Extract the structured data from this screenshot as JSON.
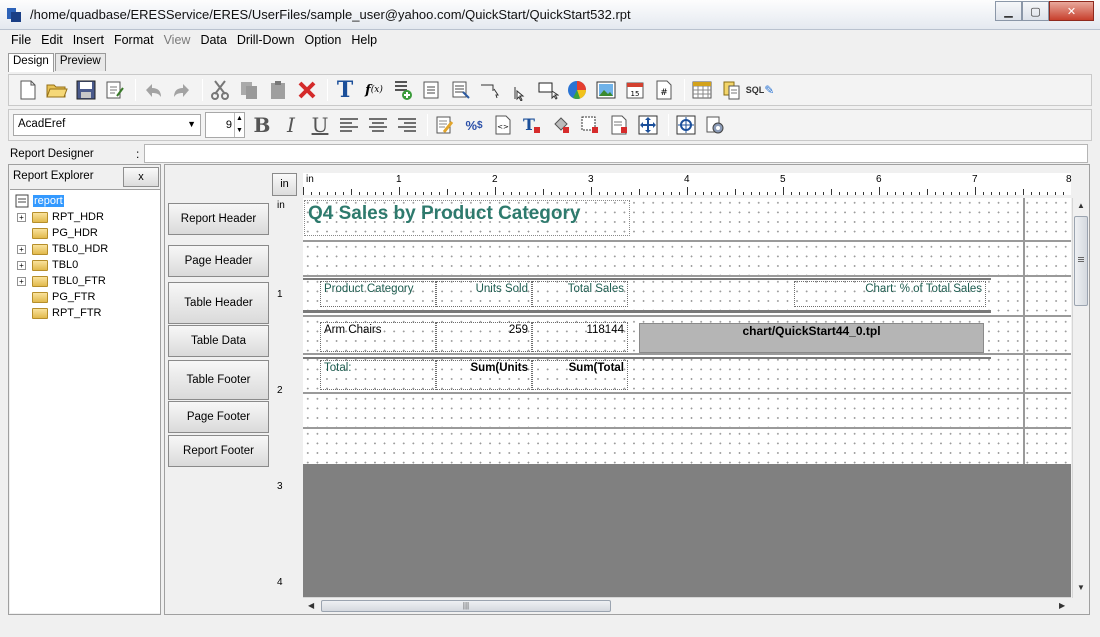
{
  "window": {
    "title": "/home/quadbase/ERESService/ERES/UserFiles/sample_user@yahoo.com/QuickStart/QuickStart532.rpt",
    "minimize": "▁",
    "maximize": "▢",
    "close": "✕"
  },
  "menu": [
    "File",
    "Edit",
    "Insert",
    "Format",
    "View",
    "Data",
    "Drill-Down",
    "Option",
    "Help"
  ],
  "tabs": [
    "Design",
    "Preview"
  ],
  "format": {
    "font": "AcadEref",
    "size": "9"
  },
  "designer": {
    "label": "Report Designer",
    "colon": ":",
    "value": ""
  },
  "explorer": {
    "title": "Report Explorer",
    "close": "x",
    "root": "report",
    "nodes": [
      "RPT_HDR",
      "PG_HDR",
      "TBL0_HDR",
      "TBL0",
      "TBL0_FTR",
      "PG_FTR",
      "RPT_FTR"
    ]
  },
  "bands": [
    "Report Header",
    "Page Header",
    "Table Header",
    "Table Data",
    "Table Footer",
    "Page Footer",
    "Report Footer"
  ],
  "unit_button": "in",
  "ruler": {
    "h": [
      "in",
      "1",
      "2",
      "3",
      "4",
      "5",
      "6",
      "7",
      "8"
    ],
    "v": [
      "in",
      "1",
      "2",
      "3",
      "4"
    ]
  },
  "report": {
    "title": "Q4 Sales by Product Category",
    "header": {
      "category": "Product Category",
      "units": "Units Sold",
      "sales": "Total Sales",
      "chart": "Chart: % of Total Sales"
    },
    "data": {
      "category": "Arm Chairs",
      "units": "259",
      "sales": "118144",
      "chart": "chart/QuickStart44_0.tpl"
    },
    "footer": {
      "label": "Total:",
      "units": "Sum(Units",
      "sales": "Sum(Total"
    }
  },
  "scroll": {
    "up": "▲",
    "down": "▼",
    "left": "◀",
    "right": "▶",
    "grip": "|||"
  }
}
